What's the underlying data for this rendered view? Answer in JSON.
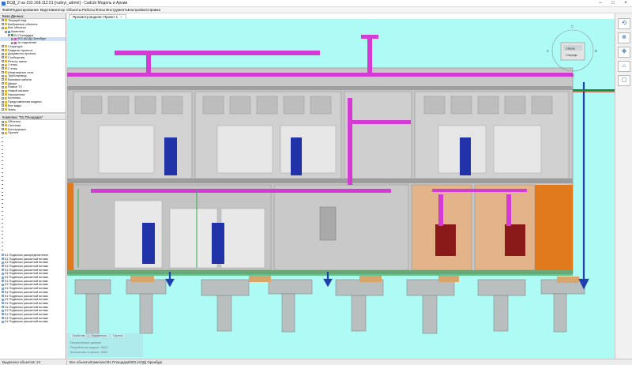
{
  "window": {
    "title": "БОД_2 на 192.168.112.51 [rudnyi_admin] - CadLib Модель и Архив",
    "accent": "#3a74c4"
  },
  "menu": [
    "Файл",
    "Редактирование",
    "Вид",
    "Навигатор",
    "Объекты",
    "Работы",
    "Фоны",
    "Инструменты",
    "Настройка",
    "Справка"
  ],
  "left_panel": {
    "header": "База Данных",
    "tree": [
      {
        "label": "Текущий вид",
        "level": 0,
        "icon": "folder"
      },
      {
        "label": "Выбранные объекты",
        "level": 0,
        "icon": "folder"
      },
      {
        "label": "Все объекты",
        "level": 0,
        "icon": "folder"
      },
      {
        "label": "Комплекс",
        "level": 1,
        "icon": "building"
      },
      {
        "label": "01.Площадка",
        "level": 2,
        "icon": "site"
      },
      {
        "label": "003 (АОД) Оренбург",
        "level": 3,
        "icon": "model",
        "selected": true
      },
      {
        "label": "1я отделение",
        "level": 3,
        "icon": "model"
      },
      {
        "label": "Структура",
        "level": 0,
        "icon": "folder"
      },
      {
        "label": "Разделы проекта",
        "level": 0,
        "icon": "folder"
      },
      {
        "label": "Документы проекта",
        "level": 0,
        "icon": "folder"
      },
      {
        "label": "Сообщения",
        "level": 0,
        "icon": "folder"
      },
      {
        "label": "Реестр папок",
        "level": 0,
        "icon": "folder"
      },
      {
        "label": "1 этаж",
        "level": 0,
        "icon": "folder"
      },
      {
        "label": "2 этаж",
        "level": 0,
        "icon": "folder"
      },
      {
        "label": "Инженерные сети",
        "level": 0,
        "icon": "folder"
      },
      {
        "label": "Трубопровод",
        "level": 0,
        "icon": "folder"
      },
      {
        "label": "Валовые кабели",
        "level": 0,
        "icon": "folder"
      },
      {
        "label": "Двери",
        "level": 0,
        "icon": "folder"
      },
      {
        "label": "Новые ТС",
        "level": 0,
        "icon": "folder"
      },
      {
        "label": "Новый каталог",
        "level": 0,
        "icon": "folder"
      },
      {
        "label": "Накопители",
        "level": 0,
        "icon": "folder"
      },
      {
        "label": "Колонны",
        "level": 0,
        "icon": "folder"
      },
      {
        "label": "Представления модели",
        "level": 0,
        "icon": "folder"
      },
      {
        "label": "Все виды",
        "level": 0,
        "icon": "folder"
      },
      {
        "label": "Фоны",
        "level": 0,
        "icon": "folder"
      }
    ],
    "lower_header": "Комплекс \"01.Площадка\"",
    "lower_tree": [
      {
        "label": "Объекты",
        "icon": "folder"
      },
      {
        "label": "Системы",
        "icon": "folder"
      },
      {
        "label": "Конструкции",
        "icon": "folder"
      },
      {
        "label": "Прочее",
        "icon": "folder"
      }
    ],
    "bottom_list": [
      "01 Подвеска распределительн",
      "01 Подвеска раскатной вставк",
      "01 Подвеска раскатной вставк",
      "01 Подвеска раскатной вставк",
      "01 Подвеска раскатной вставк",
      "01 Подвеска раскатной вставк",
      "01 Подвеска раскатной вставк",
      "01 Подвеска раскатной вставк",
      "01 Подвеска раскатной вставк",
      "01 Подвеска раскатной вставк",
      "01 Подвеска раскатной вставк",
      "01 Подвеска раскатной вставк",
      "01 Подвеска раскатной вставк",
      "01 Подвеска раскатной вставк",
      "01 Подвеска раскатной вставк",
      "01 Подвеска раскатной вставк",
      "01 Подвеска раскатной вставк",
      "01 Подвеска раскатной вставк",
      "01 Подвеска раскатной вставк"
    ]
  },
  "viewport": {
    "tab_label": "Просмотр модели: Проект 1",
    "colors": {
      "background": "#aefaf4",
      "duct_magenta": "#d43bd4",
      "wall_orange": "#e07a1c",
      "cabinet_blue": "#2233aa",
      "transformer_red": "#8a1a1a",
      "slab_green": "#1a8a2a",
      "structure_gray": "#b8b8b8"
    },
    "view_cube": {
      "top": "Сверху",
      "front": "Спереди",
      "compass_n": "С",
      "compass_s": "Ю",
      "compass_w": "З",
      "compass_e": "В"
    },
    "info_tabs": [
      "Свойства",
      "Параметры",
      "Группы"
    ],
    "info_lines": [
      "Исторические данные",
      "Разработчик модели: 3D2Z",
      "Количество в проект: 4550"
    ]
  },
  "status": {
    "selected": "Выделено объектов: 24",
    "path": "Все объекты\\Комплекс\\01.Площадка\\003 (АОД) Оренбург"
  }
}
